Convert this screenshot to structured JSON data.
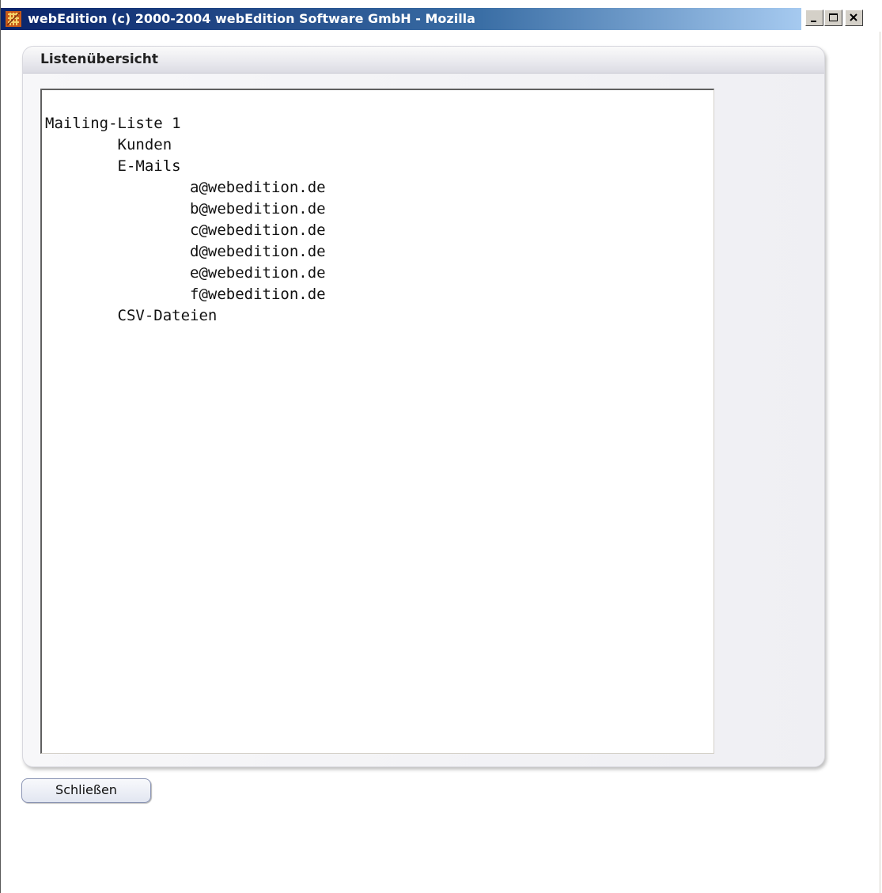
{
  "window": {
    "title": "webEdition (c) 2000-2004 webEdition Software GmbH - Mozilla",
    "titlebar_gradient": [
      "#0a246a",
      "#3a6ea5",
      "#a6caf0"
    ],
    "controls": [
      "minimize-icon",
      "maximize-icon",
      "close-icon"
    ]
  },
  "panel": {
    "title": "Listenübersicht"
  },
  "list_overview": {
    "lines": [
      "Mailing-Liste 1",
      "        Kunden",
      "        E-Mails",
      "                a@webedition.de",
      "                b@webedition.de",
      "                c@webedition.de",
      "                d@webedition.de",
      "                e@webedition.de",
      "                f@webedition.de",
      "        CSV-Dateien"
    ]
  },
  "buttons": {
    "close_label": "Schließen"
  }
}
